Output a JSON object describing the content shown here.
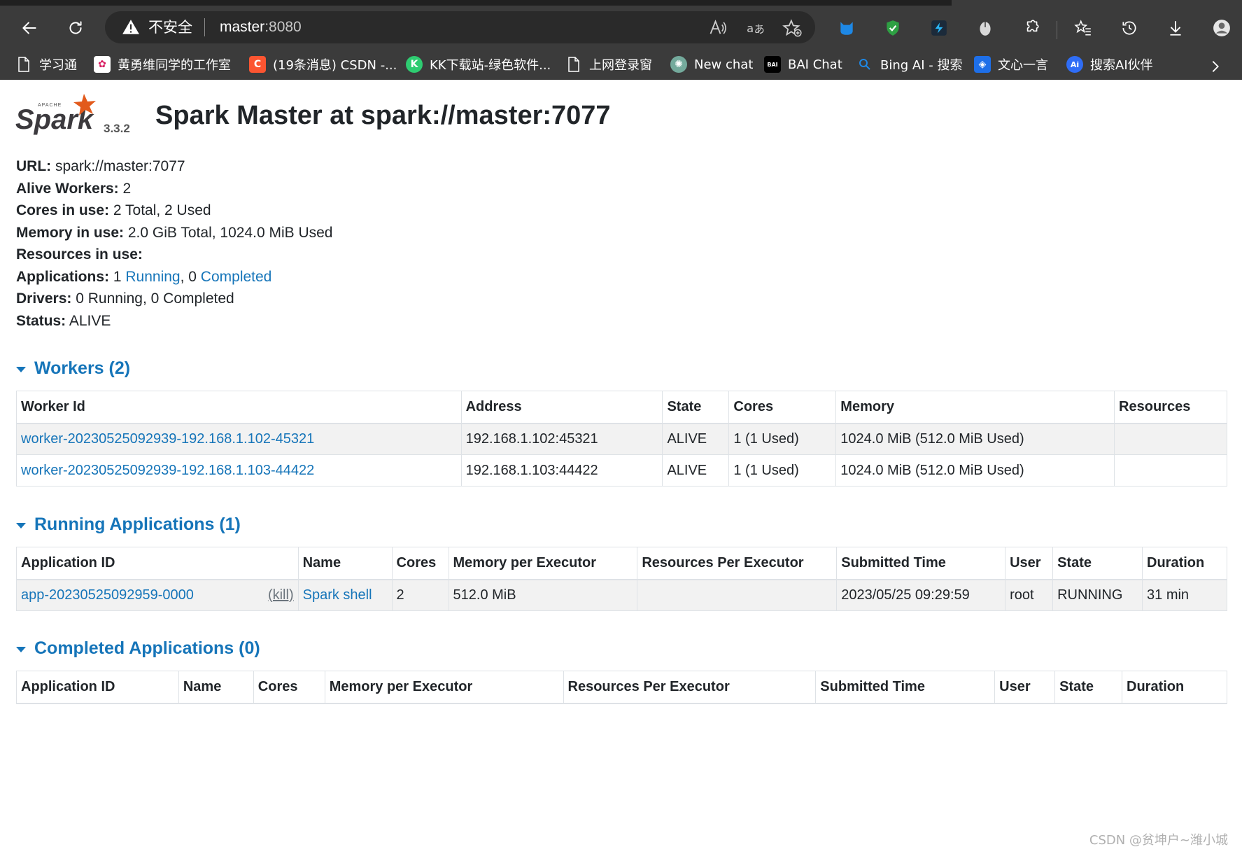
{
  "browser": {
    "insecure_label": "不安全",
    "url_host": "master",
    "url_port": ":8080",
    "bookmarks": [
      {
        "label": "学习通",
        "icon": "page-icon"
      },
      {
        "label": "黄勇维同学的工作室",
        "icon": "studio-icon"
      },
      {
        "label": "(19条消息) CSDN -...",
        "icon": "csdn-icon"
      },
      {
        "label": "KK下载站-绿色软件...",
        "icon": "kk-icon"
      },
      {
        "label": "上网登录窗",
        "icon": "page-icon"
      },
      {
        "label": "New chat",
        "icon": "chatgpt-icon"
      },
      {
        "label": "BAI Chat",
        "icon": "bai-icon"
      },
      {
        "label": "Bing AI - 搜索",
        "icon": "search-icon"
      },
      {
        "label": "文心一言",
        "icon": "wenxin-icon"
      },
      {
        "label": "搜索AI伙伴",
        "icon": "ai-partner-icon"
      }
    ]
  },
  "header": {
    "logo_word": "Spark",
    "logo_small": "APACHE",
    "version": "3.3.2",
    "title": "Spark Master at spark://master:7077"
  },
  "summary": {
    "url_label": "URL:",
    "url_value": " spark://master:7077",
    "alive_label": "Alive Workers:",
    "alive_value": " 2",
    "cores_label": "Cores in use:",
    "cores_value": " 2 Total, 2 Used",
    "memory_label": "Memory in use:",
    "memory_value": " 2.0 GiB Total, 1024.0 MiB Used",
    "resources_label": "Resources in use:",
    "apps_label": "Applications:",
    "apps_running_count": " 1 ",
    "apps_running_link": "Running",
    "apps_sep": ", 0 ",
    "apps_completed_link": "Completed",
    "drivers_label": "Drivers:",
    "drivers_value": " 0 Running, 0 Completed",
    "status_label": "Status:",
    "status_value": " ALIVE"
  },
  "workers": {
    "heading": "Workers (2)",
    "columns": [
      "Worker Id",
      "Address",
      "State",
      "Cores",
      "Memory",
      "Resources"
    ],
    "rows": [
      [
        "worker-20230525092939-192.168.1.102-45321",
        "192.168.1.102:45321",
        "ALIVE",
        "1 (1 Used)",
        "1024.0 MiB (512.0 MiB Used)",
        ""
      ],
      [
        "worker-20230525092939-192.168.1.103-44422",
        "192.168.1.103:44422",
        "ALIVE",
        "1 (1 Used)",
        "1024.0 MiB (512.0 MiB Used)",
        ""
      ]
    ]
  },
  "running": {
    "heading": "Running Applications (1)",
    "columns": [
      "Application ID",
      "Name",
      "Cores",
      "Memory per Executor",
      "Resources Per Executor",
      "Submitted Time",
      "User",
      "State",
      "Duration"
    ],
    "rows": [
      {
        "app_id": "app-20230525092959-0000",
        "kill": "(kill)",
        "name": "Spark shell",
        "cores": "2",
        "memory": "512.0 MiB",
        "resources": "",
        "submitted": "2023/05/25 09:29:59",
        "user": "root",
        "state": "RUNNING",
        "duration": "31 min"
      }
    ]
  },
  "completed": {
    "heading": "Completed Applications (0)",
    "columns": [
      "Application ID",
      "Name",
      "Cores",
      "Memory per Executor",
      "Resources Per Executor",
      "Submitted Time",
      "User",
      "State",
      "Duration"
    ]
  },
  "watermark": "CSDN @贫坤户~潍小城",
  "colors": {
    "link": "#1675b9",
    "chrome": "#3b3b3b"
  }
}
